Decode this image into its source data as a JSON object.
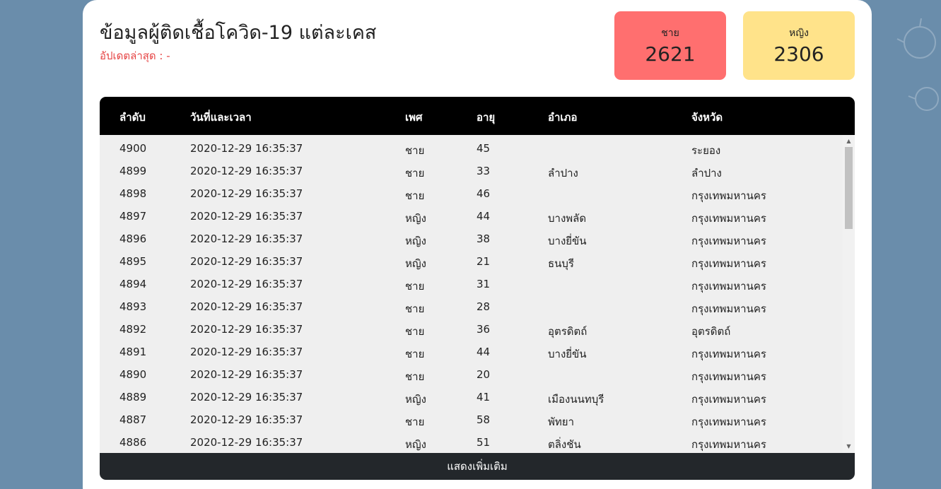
{
  "header": {
    "title": "ข้อมูลผู้ติดเชื้อโควิด-19 แต่ละเคส",
    "updated": "อัปเดตล่าสุด : -"
  },
  "stats": {
    "male_label": "ชาย",
    "male_count": "2621",
    "male_color": "#ff6f6f",
    "female_label": "หญิง",
    "female_count": "2306",
    "female_color": "#ffe38a"
  },
  "table": {
    "columns": [
      "ลำดับ",
      "วันที่และเวลา",
      "เพศ",
      "อายุ",
      "อำเภอ",
      "จังหวัด"
    ],
    "rows": [
      [
        "4900",
        "2020-12-29 16:35:37",
        "ชาย",
        "45",
        "",
        "ระยอง"
      ],
      [
        "4899",
        "2020-12-29 16:35:37",
        "ชาย",
        "33",
        "ลำปาง",
        "ลำปาง"
      ],
      [
        "4898",
        "2020-12-29 16:35:37",
        "ชาย",
        "46",
        "",
        "กรุงเทพมหานคร"
      ],
      [
        "4897",
        "2020-12-29 16:35:37",
        "หญิง",
        "44",
        "บางพลัด",
        "กรุงเทพมหานคร"
      ],
      [
        "4896",
        "2020-12-29 16:35:37",
        "หญิง",
        "38",
        "บางยี่ขัน",
        "กรุงเทพมหานคร"
      ],
      [
        "4895",
        "2020-12-29 16:35:37",
        "หญิง",
        "21",
        "ธนบุรี",
        "กรุงเทพมหานคร"
      ],
      [
        "4894",
        "2020-12-29 16:35:37",
        "ชาย",
        "31",
        "",
        "กรุงเทพมหานคร"
      ],
      [
        "4893",
        "2020-12-29 16:35:37",
        "ชาย",
        "28",
        "",
        "กรุงเทพมหานคร"
      ],
      [
        "4892",
        "2020-12-29 16:35:37",
        "ชาย",
        "36",
        "อุตรดิตถ์",
        "อุตรดิตถ์"
      ],
      [
        "4891",
        "2020-12-29 16:35:37",
        "ชาย",
        "44",
        "บางยี่ขัน",
        "กรุงเทพมหานคร"
      ],
      [
        "4890",
        "2020-12-29 16:35:37",
        "ชาย",
        "20",
        "",
        "กรุงเทพมหานคร"
      ],
      [
        "4889",
        "2020-12-29 16:35:37",
        "หญิง",
        "41",
        "เมืองนนทบุรี",
        "กรุงเทพมหานคร"
      ],
      [
        "4887",
        "2020-12-29 16:35:37",
        "ชาย",
        "58",
        "พัทยา",
        "กรุงเทพมหานคร"
      ],
      [
        "4886",
        "2020-12-29 16:35:37",
        "หญิง",
        "51",
        "ตลิ่งชัน",
        "กรุงเทพมหานคร"
      ]
    ]
  },
  "footer": {
    "more_label": "แสดงเพิ่มเติม"
  }
}
